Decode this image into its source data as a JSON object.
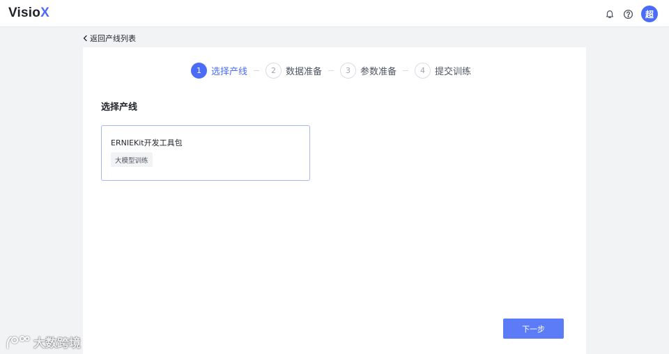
{
  "header": {
    "logo_main": "Visio",
    "logo_accent": "X",
    "avatar_text": "超",
    "icons": [
      "bell-icon",
      "help-icon"
    ]
  },
  "nav": {
    "back_label": "返回产线列表"
  },
  "steps": [
    {
      "num": "1",
      "label": "选择产线",
      "active": true
    },
    {
      "num": "2",
      "label": "数据准备",
      "active": false
    },
    {
      "num": "3",
      "label": "参数准备",
      "active": false
    },
    {
      "num": "4",
      "label": "提交训练",
      "active": false
    }
  ],
  "main": {
    "section_title": "选择产线",
    "line_card": {
      "name": "ERNIEKit开发工具包",
      "tag": "大模型训练"
    },
    "next_label": "下一步"
  },
  "watermark": {
    "text": "大数跨境"
  },
  "colors": {
    "accent": "#4a6cf7",
    "button": "#5b7cf6",
    "background": "#f2f3f5"
  }
}
